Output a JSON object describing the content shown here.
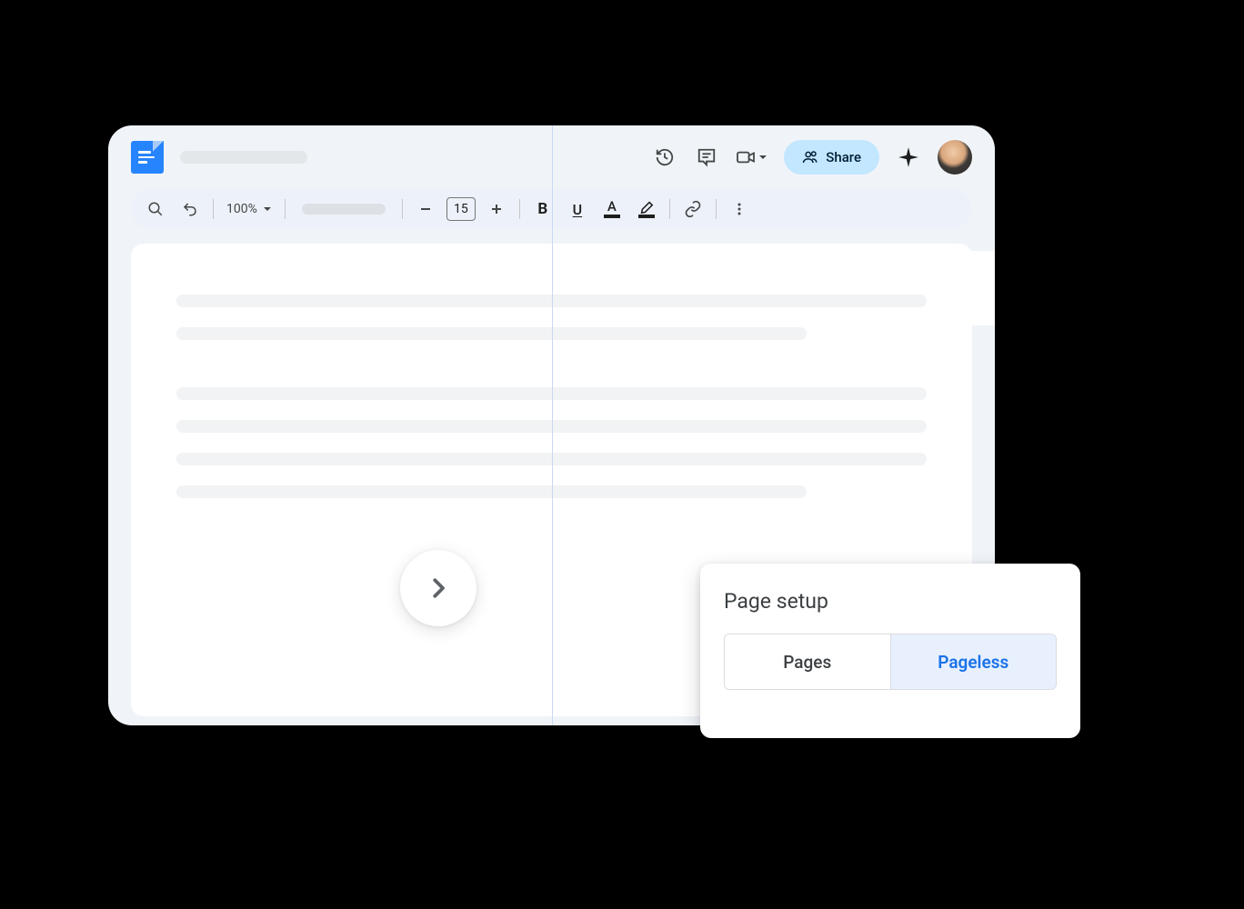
{
  "toolbar": {
    "zoom": "100%",
    "font_size": "15",
    "share_label": "Share"
  },
  "page_setup": {
    "title": "Page setup",
    "pages_label": "Pages",
    "pageless_label": "Pageless"
  }
}
